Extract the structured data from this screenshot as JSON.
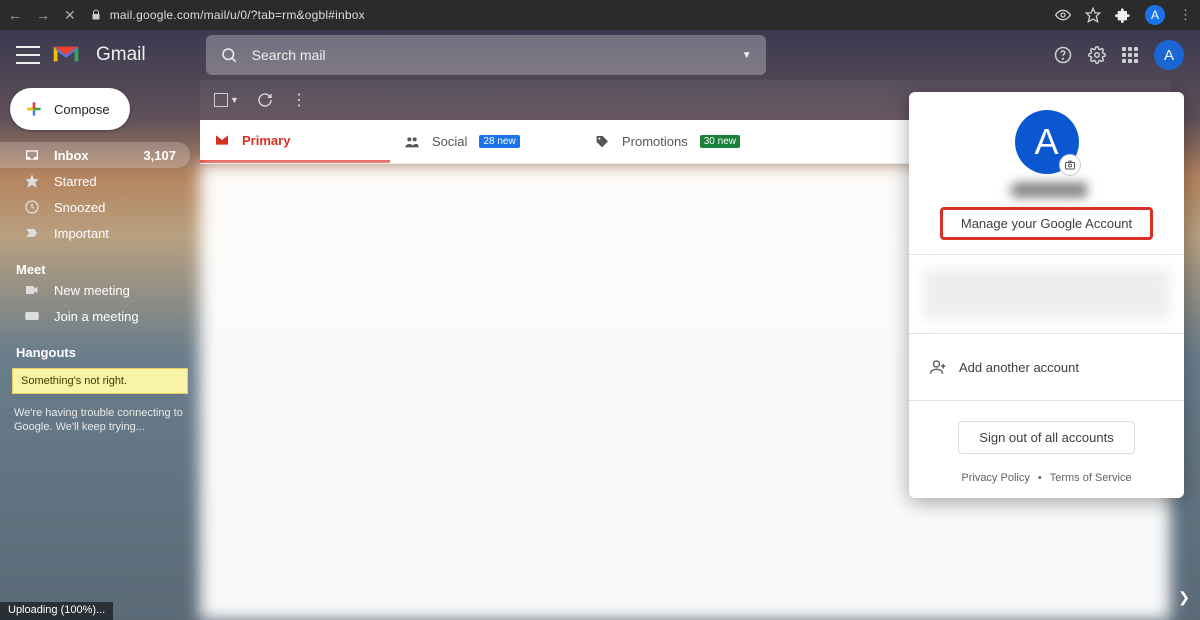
{
  "browser": {
    "url": "mail.google.com/mail/u/0/?tab=rm&ogbl#inbox",
    "avatar_letter": "A"
  },
  "header": {
    "brand": "Gmail",
    "search_placeholder": "Search mail"
  },
  "compose_label": "Compose",
  "nav": {
    "inbox": "Inbox",
    "inbox_count": "3,107",
    "starred": "Starred",
    "snoozed": "Snoozed",
    "important": "Important"
  },
  "meet": {
    "title": "Meet",
    "new_meeting": "New meeting",
    "join_meeting": "Join a meeting"
  },
  "hangouts": {
    "title": "Hangouts",
    "warning": "Something's not right.",
    "detail": "We're having trouble connecting to Google. We'll keep trying..."
  },
  "tabs": {
    "primary": "Primary",
    "social": "Social",
    "social_badge": "28 new",
    "promotions": "Promotions",
    "promotions_badge": "30 new"
  },
  "account_popover": {
    "avatar_letter": "A",
    "email_prefix": "a",
    "manage": "Manage your Google Account",
    "add_another": "Add another account",
    "sign_out": "Sign out of all accounts",
    "privacy": "Privacy Policy",
    "terms": "Terms of Service"
  },
  "status": "Uploading (100%)..."
}
